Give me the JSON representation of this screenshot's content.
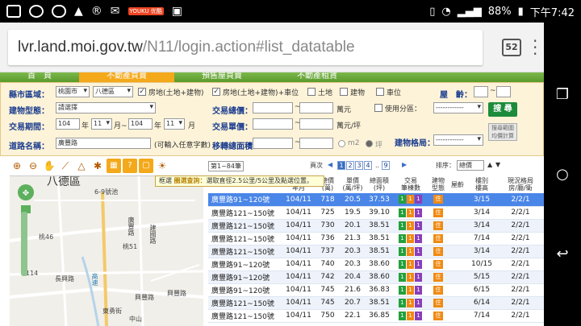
{
  "status": {
    "battery": "88%",
    "time": "下午7:42",
    "youku": "YOUKU\n优酷"
  },
  "browser": {
    "url_host": "lvr.land.moi.gov.tw",
    "url_path": "/N11/login.action#list_datatable",
    "tab_count": "52"
  },
  "topnav": {
    "tabs": [
      "首　頁",
      "不動產買賣",
      "預售屋買賣",
      "不動產租賃"
    ]
  },
  "form": {
    "county_label": "縣市區域：",
    "county_value": "桃園市",
    "district_value": "八德區",
    "type_options": [
      "房地(土地+建物)",
      "房地(土地+建物)+車位",
      "土地",
      "建物",
      "車位"
    ],
    "age_label": "屋　齡：",
    "building_type_label": "建物型態：",
    "building_type_value": "請選擇",
    "total_price_label": "交易總價：",
    "unit_wan": "萬元",
    "use_zone_label": "使用分區：",
    "use_zone_value": "------------",
    "search_btn": "搜 尋",
    "period_label": "交易期間：",
    "period_from_year": "104",
    "period_from_month": "11",
    "period_to_year": "104",
    "period_to_month": "11",
    "year": "年",
    "month_to": "月~",
    "month": "月",
    "unit_price_label": "交易單價：",
    "unit_wan_ping": "萬元/坪",
    "layout_label": "建物格局：",
    "layout_value": "------------",
    "calc_btn": "搜尋範圍\n均價計算",
    "road_label": "道路名稱：",
    "road_value": "廣豐路",
    "road_hint": "(可輸入任意字數)",
    "area_label": "移轉總面積：",
    "m2": "m2",
    "ping": "坪"
  },
  "map": {
    "district": "八德區",
    "labels": [
      "6-9號池",
      "廣豐路",
      "建國路",
      "桃46",
      "桃51",
      "114",
      "長興路",
      "東勇街",
      "興豐路",
      "興豐路",
      "中山",
      "高速"
    ]
  },
  "tooltip": {
    "label": "框選",
    "title": "圈選查詢：",
    "text": "選取直徑2.5公里/5公里及點選位置。"
  },
  "pager": {
    "range": "第1~84筆",
    "page_label": "頁次",
    "pages": [
      "1",
      "2",
      "3",
      "4",
      "..",
      "9"
    ],
    "sort_label": "排序：",
    "sort_value": "總價"
  },
  "table": {
    "headers": [
      "",
      "交易\n年月",
      "總價\n(萬)",
      "單價\n(萬/坪)",
      "總面積\n(坪)",
      "交易\n筆棟數",
      "建物\n型態",
      "屋齡",
      "樓別\n樓高",
      "現況格局\n房/廳/衛"
    ],
    "rows": [
      {
        "addr": "廣豐路91~120號",
        "ym": "104/11",
        "total": "718",
        "unit": "20.5",
        "area": "37.53",
        "b1": "1",
        "b2": "1",
        "b3": "1",
        "type": "住",
        "age": "",
        "floor": "3/15",
        "layout": "2/2/1"
      },
      {
        "addr": "廣豐路121~150號",
        "ym": "104/11",
        "total": "725",
        "unit": "19.5",
        "area": "39.10",
        "b1": "1",
        "b2": "1",
        "b3": "1",
        "type": "住",
        "age": "",
        "floor": "3/14",
        "layout": "2/2/1"
      },
      {
        "addr": "廣豐路121~150號",
        "ym": "104/11",
        "total": "730",
        "unit": "20.1",
        "area": "38.51",
        "b1": "1",
        "b2": "1",
        "b3": "1",
        "type": "住",
        "age": "",
        "floor": "3/14",
        "layout": "2/2/1"
      },
      {
        "addr": "廣豐路121~150號",
        "ym": "104/11",
        "total": "736",
        "unit": "21.3",
        "area": "38.51",
        "b1": "1",
        "b2": "1",
        "b3": "1",
        "type": "住",
        "age": "",
        "floor": "7/14",
        "layout": "2/2/1"
      },
      {
        "addr": "廣豐路121~150號",
        "ym": "104/11",
        "total": "737",
        "unit": "20.3",
        "area": "38.51",
        "b1": "1",
        "b2": "1",
        "b3": "1",
        "type": "住",
        "age": "",
        "floor": "3/14",
        "layout": "2/2/1"
      },
      {
        "addr": "廣豐路91~120號",
        "ym": "104/11",
        "total": "740",
        "unit": "20.3",
        "area": "38.60",
        "b1": "1",
        "b2": "1",
        "b3": "1",
        "type": "住",
        "age": "",
        "floor": "10/15",
        "layout": "2/2/1"
      },
      {
        "addr": "廣豐路91~120號",
        "ym": "104/11",
        "total": "742",
        "unit": "20.4",
        "area": "38.60",
        "b1": "1",
        "b2": "1",
        "b3": "1",
        "type": "住",
        "age": "",
        "floor": "5/15",
        "layout": "2/2/1"
      },
      {
        "addr": "廣豐路91~120號",
        "ym": "104/11",
        "total": "745",
        "unit": "21.6",
        "area": "36.83",
        "b1": "1",
        "b2": "1",
        "b3": "1",
        "type": "住",
        "age": "",
        "floor": "6/15",
        "layout": "2/2/1"
      },
      {
        "addr": "廣豐路121~150號",
        "ym": "104/11",
        "total": "745",
        "unit": "20.7",
        "area": "38.51",
        "b1": "1",
        "b2": "1",
        "b3": "1",
        "type": "住",
        "age": "",
        "floor": "6/14",
        "layout": "2/2/1"
      },
      {
        "addr": "廣豐路121~150號",
        "ym": "104/11",
        "total": "750",
        "unit": "22.1",
        "area": "36.85",
        "b1": "1",
        "b2": "1",
        "b3": "1",
        "type": "住",
        "age": "",
        "floor": "7/14",
        "layout": "2/2/1"
      }
    ]
  },
  "colors": {
    "selected_row": "#4a86e8",
    "badge_land": "#23a03c",
    "badge_building": "#f08a12",
    "badge_parking": "#8a3fb8"
  }
}
